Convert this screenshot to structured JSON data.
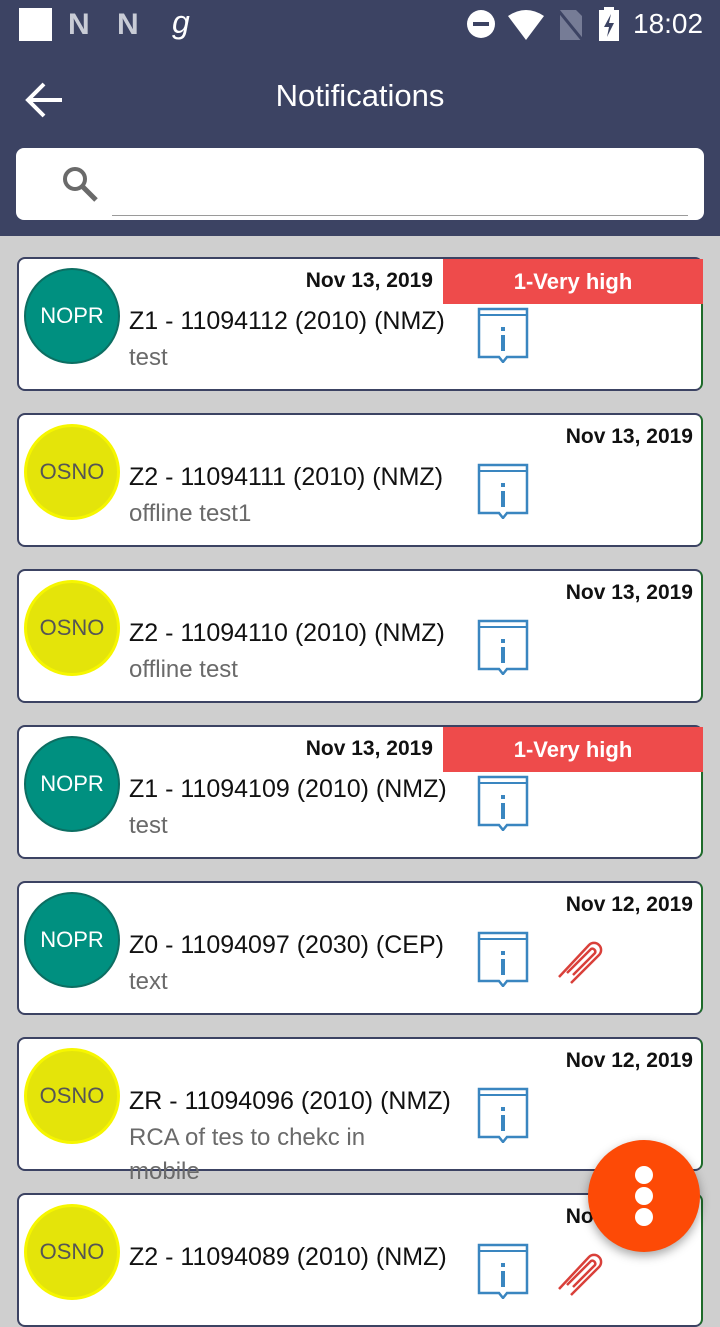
{
  "status_bar": {
    "time": "18:02",
    "icons": [
      "square-icon",
      "n-notification-icon",
      "n-notification-icon",
      "g-notification-icon",
      "dnd-icon",
      "wifi-icon",
      "no-sim-icon",
      "battery-charging-icon"
    ]
  },
  "header": {
    "title": "Notifications",
    "back_icon": "arrow-left-icon"
  },
  "search": {
    "placeholder": "",
    "value": "",
    "icon": "search-icon"
  },
  "colors": {
    "appbar": "#3c4363",
    "nopr": "#009080",
    "osno": "#e4e40a",
    "priority": "#ee4b4b",
    "fab": "#fd4a06",
    "info_icon": "#3a86c0",
    "clip_icon": "#d9403a"
  },
  "notifications": [
    {
      "type": "NOPR",
      "date": "Nov 13, 2019",
      "priority": "1-Very high",
      "title": "Z1  -  11094112 (2010) (NMZ)",
      "desc": "test",
      "attachment": false
    },
    {
      "type": "OSNO",
      "date": "Nov 13, 2019",
      "priority": "",
      "title": "Z2  -  11094111 (2010) (NMZ)",
      "desc": "offline test1",
      "attachment": false
    },
    {
      "type": "OSNO",
      "date": "Nov 13, 2019",
      "priority": "",
      "title": "Z2  -  11094110 (2010) (NMZ)",
      "desc": "offline test",
      "attachment": false
    },
    {
      "type": "NOPR",
      "date": "Nov 13, 2019",
      "priority": "1-Very high",
      "title": "Z1  -  11094109 (2010) (NMZ)",
      "desc": "test",
      "attachment": false
    },
    {
      "type": "NOPR",
      "date": "Nov 12, 2019",
      "priority": "",
      "title": "Z0  -  11094097 (2030) (CEP)",
      "desc": "text",
      "attachment": true
    },
    {
      "type": "OSNO",
      "date": "Nov 12, 2019",
      "priority": "",
      "title": "ZR  -  11094096 (2010) (NMZ)",
      "desc": "RCA of tes to chekc in mobile",
      "attachment": false
    },
    {
      "type": "OSNO",
      "date": "Nov 12, 2019",
      "priority": "",
      "title": "Z2  -  11094089 (2010) (NMZ)",
      "desc": "",
      "attachment": true
    }
  ],
  "fab": {
    "icon": "more-vertical-icon"
  }
}
